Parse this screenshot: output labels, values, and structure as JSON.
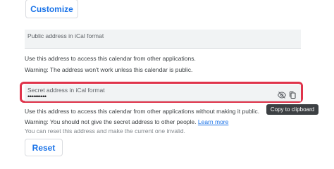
{
  "customize_button": "Customize",
  "public_section": {
    "label": "Public address in iCal format",
    "description": "Use this address to access this calendar from other applications.",
    "warning": "Warning: The address won't work unless this calendar is public."
  },
  "secret_section": {
    "label": "Secret address in iCal format",
    "value": "••••••••••",
    "visibility_icon": "eye-off-icon",
    "copy_icon": "copy-icon",
    "tooltip": "Copy to clipboard",
    "description": "Use this address to access this calendar from other applications without making it public.",
    "warning": "Warning: You should not give the secret address to other people.",
    "learn_more": "Learn more",
    "reset_note": "You can reset this address and make the current one invalid.",
    "highlight_color": "#e0344b"
  },
  "reset_button": "Reset"
}
